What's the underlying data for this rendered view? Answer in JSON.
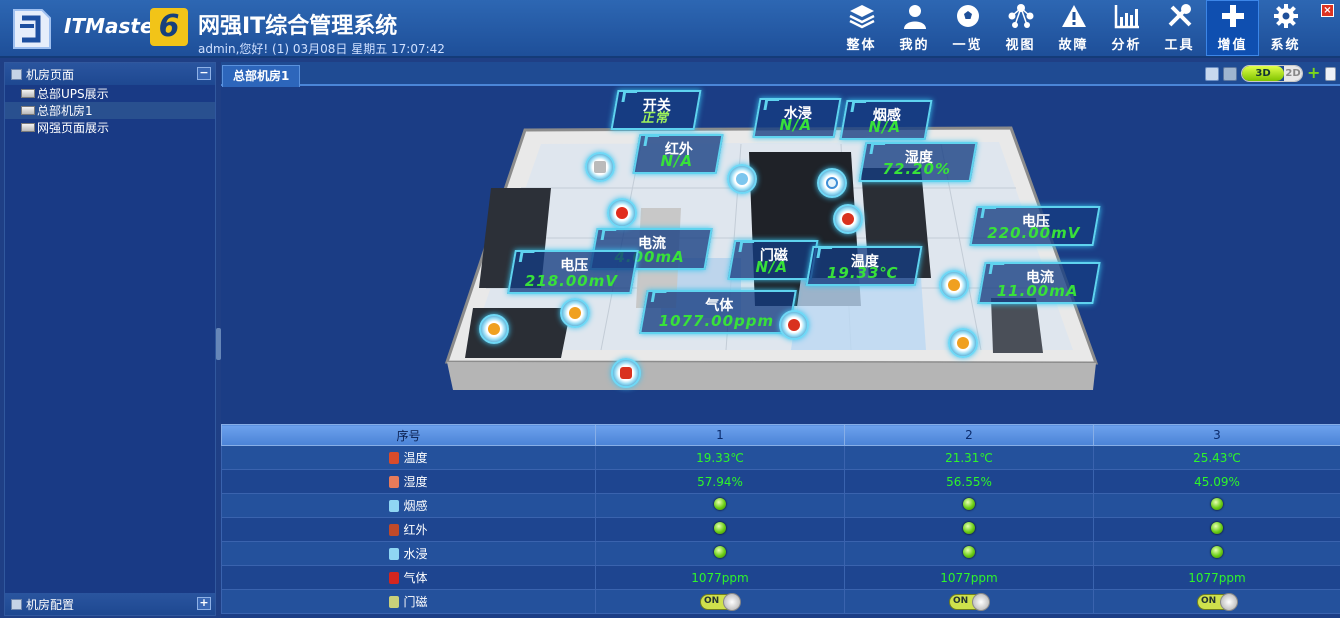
{
  "header": {
    "brand": "ITMaster",
    "brand_version": "6",
    "title": "网强IT综合管理系统",
    "user_info": "admin,您好! (1) 03月08日 星期五 17:07:42",
    "nav": [
      {
        "label": "整体",
        "icon": "layers-icon"
      },
      {
        "label": "我的",
        "icon": "user-icon"
      },
      {
        "label": "一览",
        "icon": "football-icon"
      },
      {
        "label": "视图",
        "icon": "network-icon"
      },
      {
        "label": "故障",
        "icon": "warning-icon"
      },
      {
        "label": "分析",
        "icon": "chart-icon"
      },
      {
        "label": "工具",
        "icon": "tools-icon"
      },
      {
        "label": "增值",
        "icon": "plus-icon"
      },
      {
        "label": "系统",
        "icon": "gear-icon"
      }
    ],
    "active_nav": "增值"
  },
  "sidebar": {
    "top_panel": "机房页面",
    "items": [
      "总部UPS展示",
      "总部机房1",
      "网强页面展示"
    ],
    "selected_item": "总部机房1",
    "bottom_panel": "机房配置"
  },
  "tab": {
    "label": "总部机房1"
  },
  "view_toggle": {
    "three_d": "3D",
    "two_d": "2D"
  },
  "sensors": [
    {
      "name": "开关",
      "value": "正常"
    },
    {
      "name": "水浸",
      "value": "N/A"
    },
    {
      "name": "烟感",
      "value": "N/A"
    },
    {
      "name": "红外",
      "value": "N/A"
    },
    {
      "name": "湿度",
      "value": "72.20%"
    },
    {
      "name": "电压",
      "value": "220.00mV"
    },
    {
      "name": "电流",
      "value": "4.00mA"
    },
    {
      "name": "门磁",
      "value": "N/A"
    },
    {
      "name": "温度",
      "value": "19.33℃"
    },
    {
      "name": "电压",
      "value": "218.00mV"
    },
    {
      "name": "电流",
      "value": "11.00mA"
    },
    {
      "name": "气体",
      "value": "1077.00ppm"
    }
  ],
  "table": {
    "header_label": "序号",
    "columns": [
      "1",
      "2",
      "3"
    ],
    "rows": [
      {
        "label": "温度",
        "kind": "text",
        "values": [
          "19.33℃",
          "21.31℃",
          "25.43℃"
        ],
        "color": "#d94c2b"
      },
      {
        "label": "湿度",
        "kind": "text",
        "values": [
          "57.94%",
          "56.55%",
          "45.09%"
        ],
        "color": "#e77b5a"
      },
      {
        "label": "烟感",
        "kind": "dot",
        "values": [
          "on",
          "on",
          "on"
        ],
        "color": "#8fd6f3"
      },
      {
        "label": "红外",
        "kind": "dot",
        "values": [
          "on",
          "on",
          "on"
        ],
        "color": "#c04a2a"
      },
      {
        "label": "水浸",
        "kind": "dot",
        "values": [
          "on",
          "on",
          "on"
        ],
        "color": "#8fd6f3"
      },
      {
        "label": "气体",
        "kind": "text",
        "values": [
          "1077ppm",
          "1077ppm",
          "1077ppm"
        ],
        "color": "#d4261f"
      },
      {
        "label": "门磁",
        "kind": "switch",
        "values": [
          "ON",
          "ON",
          "ON"
        ],
        "color": "#c9d07a"
      }
    ]
  }
}
